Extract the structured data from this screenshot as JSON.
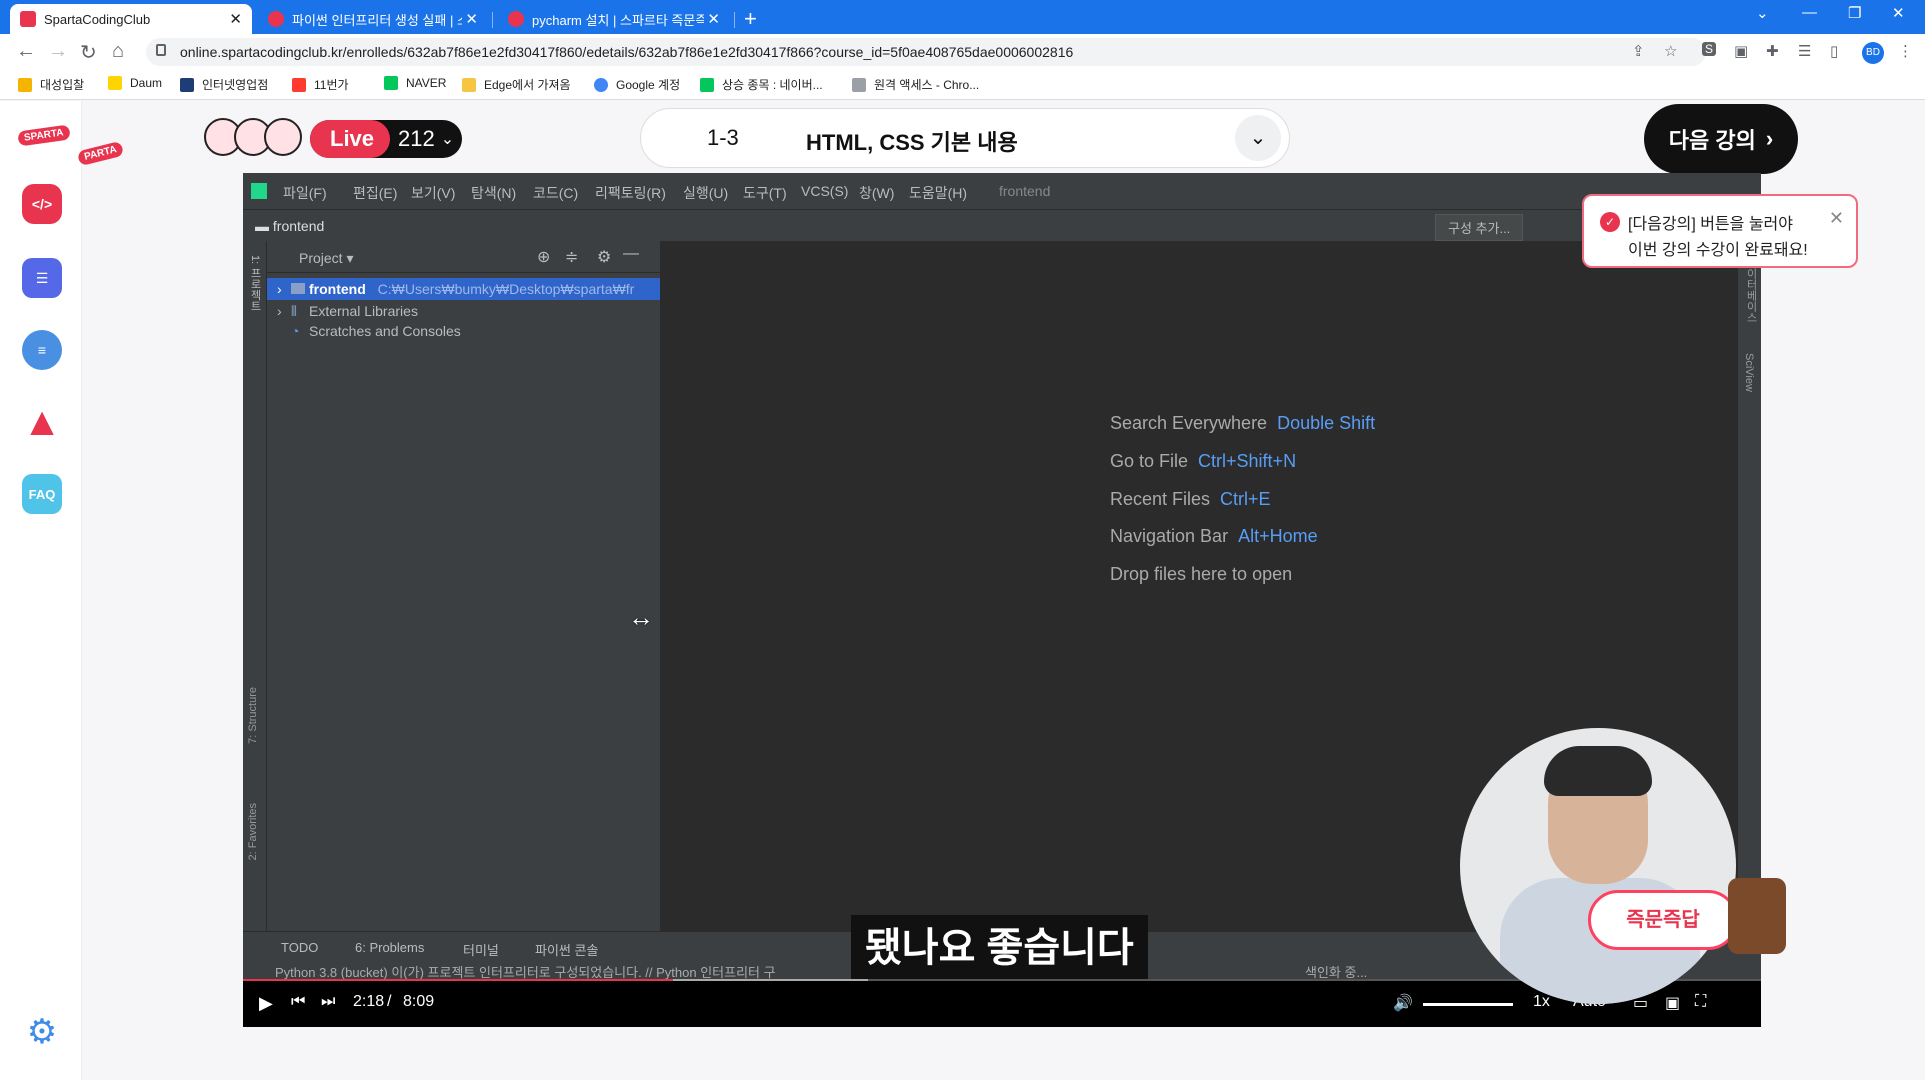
{
  "browser": {
    "tabs": [
      {
        "label": "SpartaCodingClub",
        "active": true
      },
      {
        "label": "파이썬 인터프리터 생성 실패 | 스",
        "active": false
      },
      {
        "label": "pycharm 설치 | 스파르타 즉문즉",
        "active": false
      }
    ],
    "url": "online.spartacodingclub.kr/enrolleds/632ab7f86e1e2fd30417f860/edetails/632ab7f86e1e2fd30417f866?course_id=5f0ae408765dae0006002816",
    "avatar": "BD",
    "bookmarks": [
      "대성입찰",
      "Daum",
      "인터넷영업점",
      "11번가",
      "NAVER",
      "Edge에서 가져옴",
      "Google 계정",
      "상승 종목 : 네이버...",
      "원격 액세스 - Chro..."
    ]
  },
  "header": {
    "live_label": "Live",
    "live_count": "212",
    "lecture_number": "1-3",
    "lecture_title": "HTML, CSS 기본 내용",
    "next_button": "다음 강의"
  },
  "tooltip": {
    "line1": "[다음강의] 버튼을 눌러야",
    "line2": "이번 강의 수강이 완료돼요!"
  },
  "sidebar": {
    "faq": "FAQ"
  },
  "ide": {
    "menu": [
      "파일(F)",
      "편집(E)",
      "보기(V)",
      "탐색(N)",
      "코드(C)",
      "리팩토링(R)",
      "실행(U)",
      "도구(T)",
      "VCS(S)",
      "창(W)",
      "도움말(H)"
    ],
    "project_name": "frontend",
    "breadcrumb": "frontend",
    "config_button": "구성 추가...",
    "project_panel_title": "Project",
    "tree": [
      {
        "label": "frontend",
        "path": "C:₩Users₩bumky₩Desktop₩sparta₩fr"
      },
      {
        "label": "External Libraries",
        "path": ""
      },
      {
        "label": "Scratches and Consoles",
        "path": ""
      }
    ],
    "hints": [
      {
        "label": "Search Everywhere",
        "shortcut": "Double Shift"
      },
      {
        "label": "Go to File",
        "shortcut": "Ctrl+Shift+N"
      },
      {
        "label": "Recent Files",
        "shortcut": "Ctrl+E"
      },
      {
        "label": "Navigation Bar",
        "shortcut": "Alt+Home"
      },
      {
        "label": "Drop files here to open",
        "shortcut": ""
      }
    ],
    "left_tabs": [
      "1: 프로젝트",
      "7: Structure",
      "2: Favorites"
    ],
    "right_tabs": [
      "데이터베이스",
      "SciView"
    ],
    "bottom_tabs": [
      "TODO",
      "6: Problems",
      "터미널",
      "파이썬 콘솔"
    ],
    "status": "Python 3.8 (bucket) 이(가) 프로젝트 인터프리터로 구성되었습니다. // Python 인터프리터 구",
    "indexing": "색인화 중..."
  },
  "video": {
    "subtitle": "됐나요 좋습니다",
    "current_time": "2:18",
    "duration": "8:09",
    "speed": "1x",
    "quality": "Auto",
    "progress_fraction": 0.283,
    "buffered_fraction": 0.412,
    "badge": "즉문즉답"
  }
}
